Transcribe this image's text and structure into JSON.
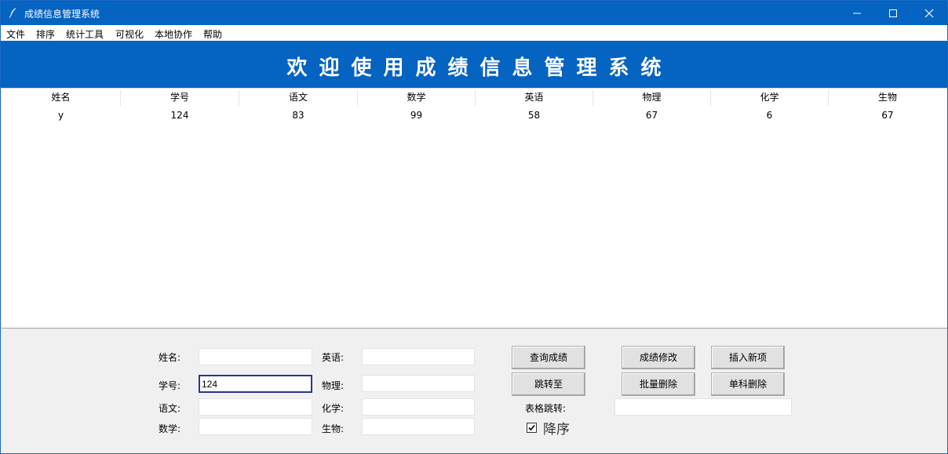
{
  "window": {
    "title": "成绩信息管理系统",
    "icon": "feather-icon"
  },
  "menu": [
    "文件",
    "排序",
    "统计工具",
    "可视化",
    "本地协作",
    "帮助"
  ],
  "banner": {
    "text": "欢迎使用成绩信息管理系统"
  },
  "table": {
    "columns": [
      "姓名",
      "学号",
      "语文",
      "数学",
      "英语",
      "物理",
      "化学",
      "生物"
    ],
    "rows": [
      [
        "y",
        "124",
        "83",
        "99",
        "58",
        "67",
        "6",
        "67"
      ]
    ]
  },
  "form": {
    "labels": {
      "name": "姓名:",
      "id": "学号:",
      "chinese": "语文:",
      "math": "数学:",
      "english": "英语:",
      "physics": "物理:",
      "chemistry": "化学:",
      "biology": "生物:",
      "jump": "表格跳转:"
    },
    "values": {
      "name": "",
      "id": "124",
      "chinese": "",
      "math": "",
      "english": "",
      "physics": "",
      "chemistry": "",
      "biology": "",
      "jump": ""
    },
    "buttons": {
      "query": "查询成绩",
      "jump_to": "跳转至",
      "modify": "成绩修改",
      "batch_delete": "批量删除",
      "insert": "插入新项",
      "single_delete": "单科删除"
    },
    "descending": {
      "label": "降序",
      "checked": true
    }
  },
  "colors": {
    "accent": "#0563c1",
    "banner_text": "#ffffff",
    "form_bg": "#f0f0f0"
  }
}
